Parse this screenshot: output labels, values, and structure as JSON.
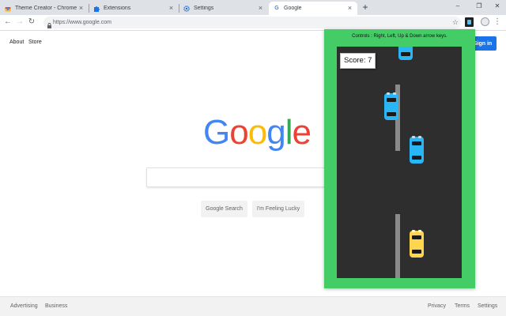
{
  "tabs": [
    {
      "title": "Theme Creator - Chrome Web St",
      "icon": "chrome-webstore-icon"
    },
    {
      "title": "Extensions",
      "icon": "puzzle-icon"
    },
    {
      "title": "Settings",
      "icon": "gear-icon"
    },
    {
      "title": "Google",
      "icon": "google-g-icon",
      "active": true
    }
  ],
  "omnibox": {
    "url": "https://www.google.com"
  },
  "google": {
    "about": "About",
    "store": "Store",
    "sign_in": "Sign in",
    "logo": [
      "G",
      "o",
      "o",
      "g",
      "l",
      "e"
    ],
    "logo_colors": [
      "#4285f4",
      "#ea4335",
      "#fbbc05",
      "#4285f4",
      "#34a853",
      "#ea4335"
    ],
    "search_button": "Google Search",
    "lucky_button": "I'm Feeling Lucky"
  },
  "footer": {
    "advertising": "Advertising",
    "business": "Business",
    "privacy": "Privacy",
    "terms": "Terms",
    "settings": "Settings"
  },
  "game": {
    "controls": "Controls : Right, Left, Up & Down arrow keys.",
    "score_label": "Score:",
    "score": 7,
    "colors": {
      "panel": "#44cc66",
      "road": "#2e2e2e",
      "player_car": "#ffd54f",
      "enemy_car": "#29b6f6"
    }
  }
}
